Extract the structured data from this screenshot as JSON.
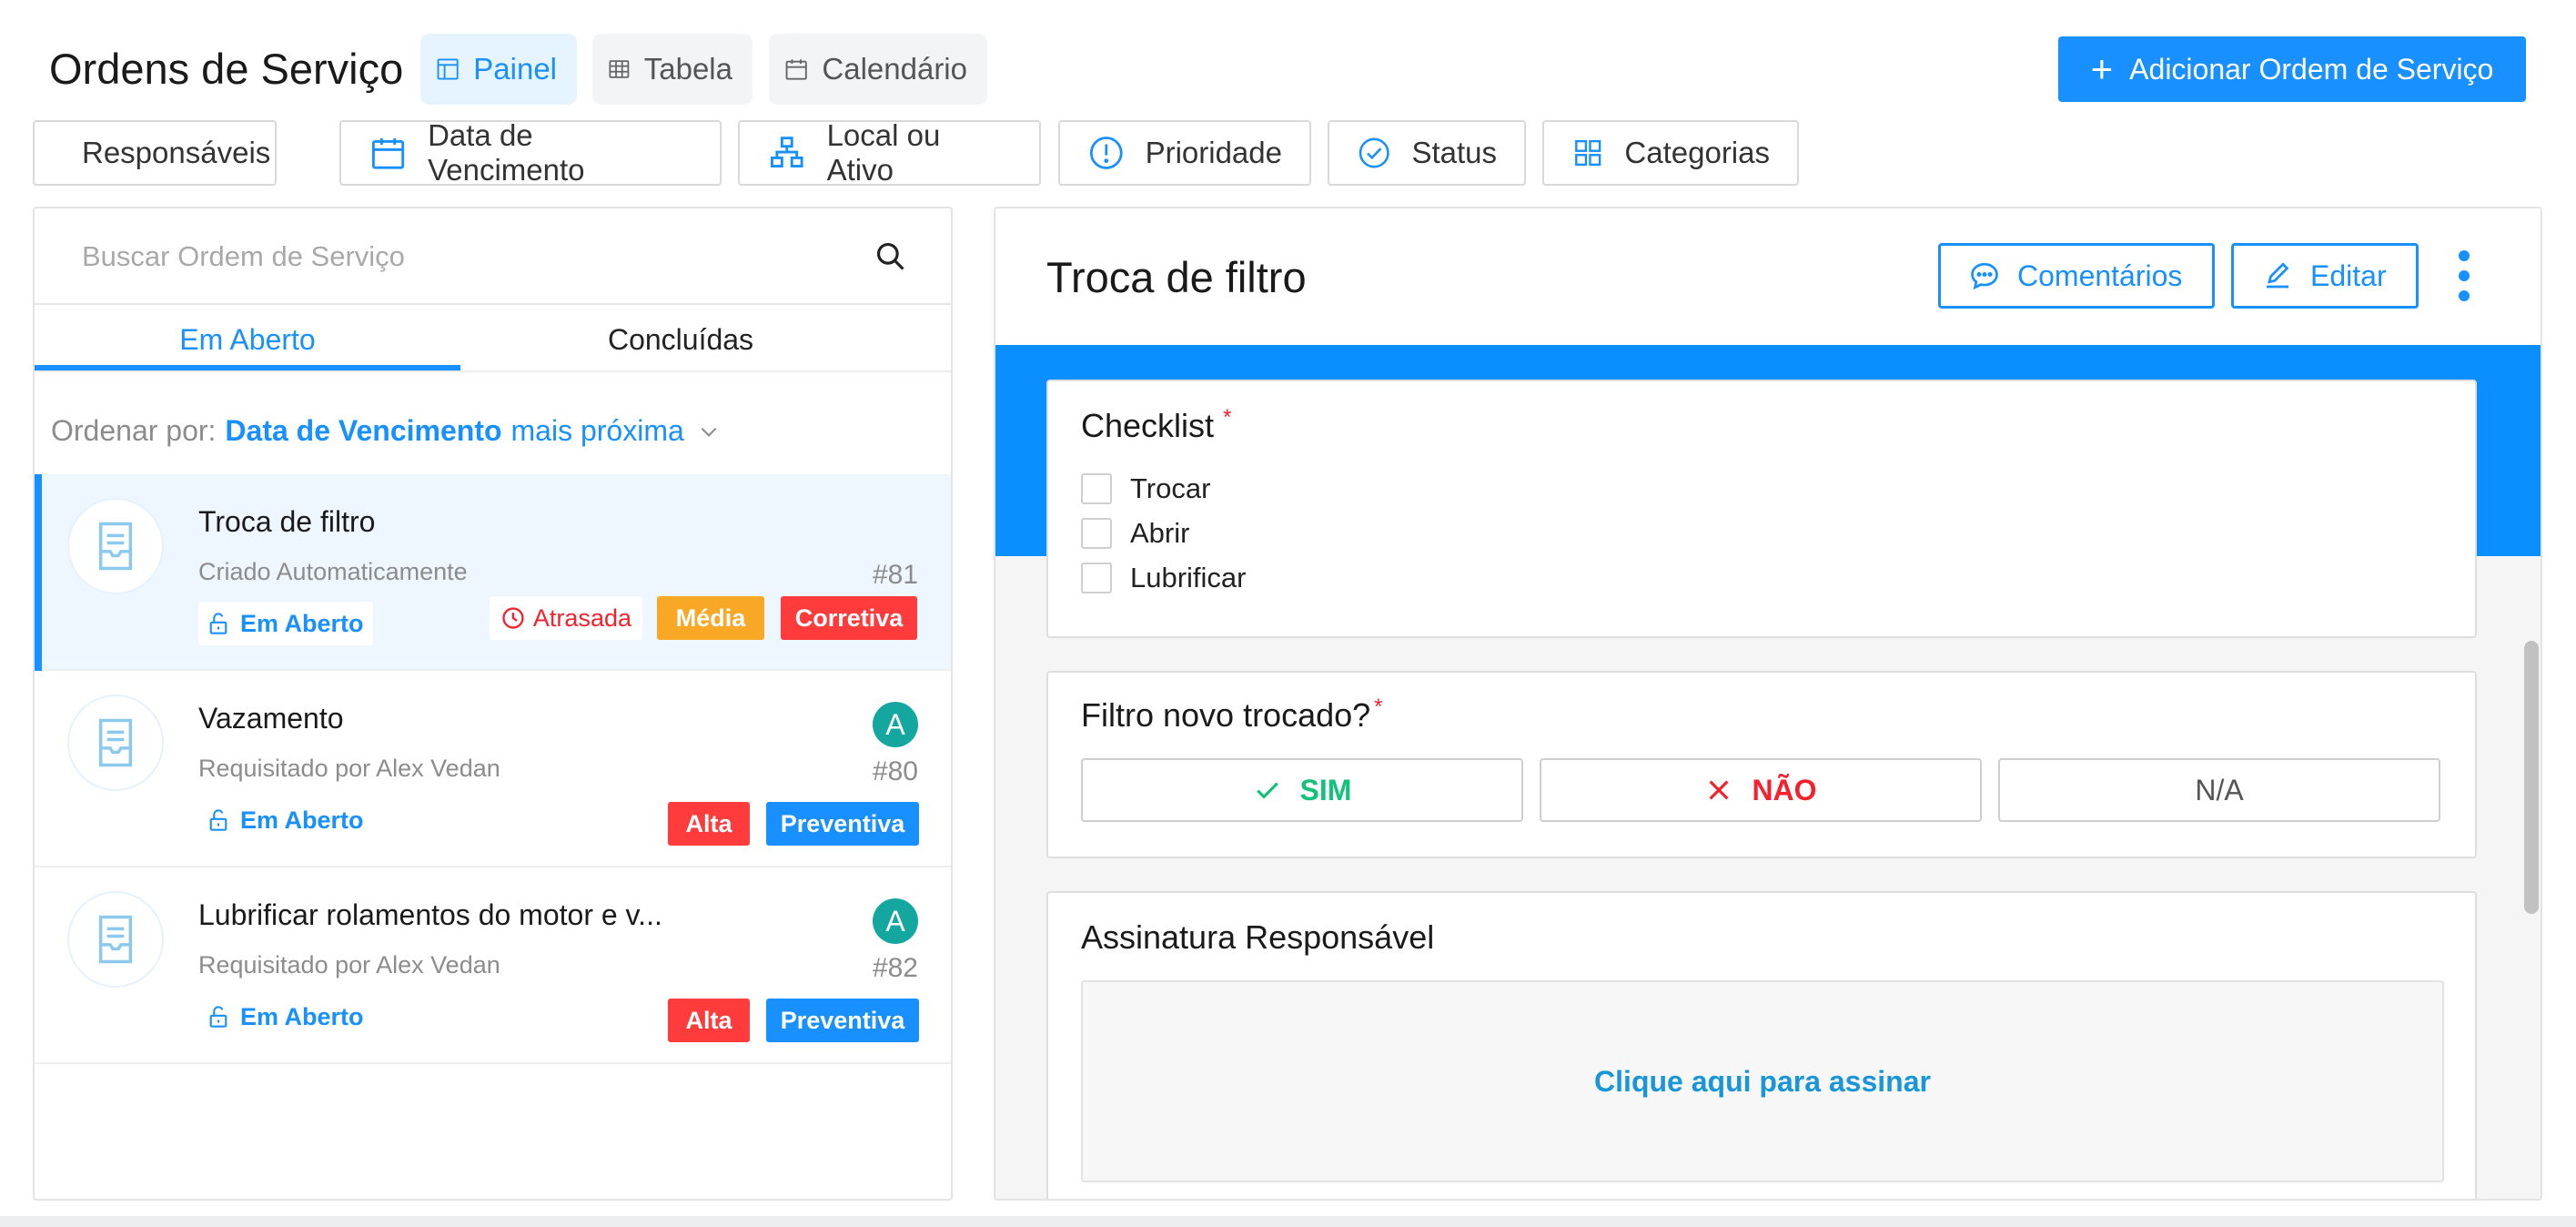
{
  "header": {
    "title": "Ordens de Serviço",
    "views": [
      {
        "label": "Painel",
        "icon": "board-icon",
        "active": true
      },
      {
        "label": "Tabela",
        "icon": "table-icon",
        "active": false
      },
      {
        "label": "Calendário",
        "icon": "calendar-icon",
        "active": false
      }
    ],
    "add_button": "Adicionar Ordem de Serviço"
  },
  "filters": [
    {
      "label": "Responsáveis",
      "icon": "user-icon"
    },
    {
      "label": "Data de Vencimento",
      "icon": "calendar-icon"
    },
    {
      "label": "Local ou Ativo",
      "icon": "hierarchy-icon"
    },
    {
      "label": "Prioridade",
      "icon": "exclamation-icon"
    },
    {
      "label": "Status",
      "icon": "check-circle-icon"
    },
    {
      "label": "Categorias",
      "icon": "grid-icon"
    }
  ],
  "list": {
    "search_placeholder": "Buscar Ordem de Serviço",
    "tabs": [
      "Em Aberto",
      "Concluídas"
    ],
    "active_tab": "Em Aberto",
    "sort": {
      "label": "Ordenar por:",
      "field": "Data de Vencimento",
      "direction": "mais próxima"
    },
    "items": [
      {
        "title": "Troca de filtro",
        "subtitle": "Criado Automaticamente",
        "status": "Em Aberto",
        "number": "#81",
        "late_label": "Atrasada",
        "priority": "Média",
        "type": "Corretiva",
        "assignee_initial": "",
        "selected": true
      },
      {
        "title": "Vazamento",
        "subtitle": "Requisitado por Alex Vedan",
        "status": "Em Aberto",
        "number": "#80",
        "priority": "Alta",
        "type": "Preventiva",
        "assignee_initial": "A",
        "selected": false
      },
      {
        "title": "Lubrificar rolamentos do motor e v...",
        "subtitle": "Requisitado por Alex Vedan",
        "status": "Em Aberto",
        "number": "#82",
        "priority": "Alta",
        "type": "Preventiva",
        "assignee_initial": "A",
        "selected": false
      }
    ]
  },
  "detail": {
    "title": "Troca de filtro",
    "comments_button": "Comentários",
    "edit_button": "Editar",
    "checklist": {
      "title": "Checklist",
      "required_mark": "*",
      "items": [
        "Trocar",
        "Abrir",
        "Lubrificar"
      ]
    },
    "question": {
      "title": "Filtro novo trocado?",
      "required_mark": "*",
      "options": [
        "SIM",
        "NÃO",
        "N/A"
      ]
    },
    "signature": {
      "title": "Assinatura Responsável",
      "action": "Clique aqui para assinar"
    }
  },
  "colors": {
    "primary": "#1890ff",
    "band": "#0b8eff",
    "danger": "#ff3b3b",
    "warning": "#f9a825",
    "success": "#13c27a",
    "teal": "#14a7a0"
  }
}
